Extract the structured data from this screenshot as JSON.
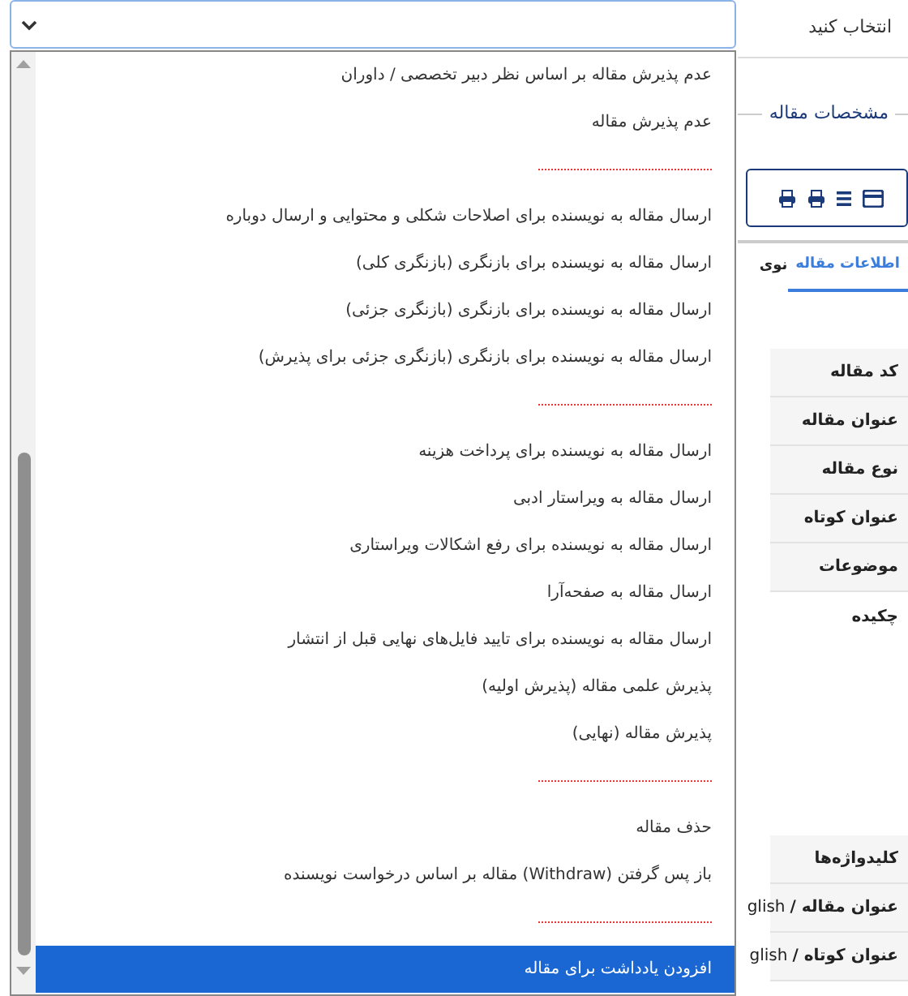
{
  "field_label": "انتخاب کنید",
  "section_title": "مشخصات مقاله",
  "tabs": [
    {
      "label": "اطلاعات مقاله",
      "selected": true
    },
    {
      "label": "نوی",
      "selected": false
    }
  ],
  "info_rows": [
    {
      "label": "کد مقاله"
    },
    {
      "label": "عنوان مقاله"
    },
    {
      "label": "نوع مقاله"
    },
    {
      "label": "عنوان کوتاه"
    },
    {
      "label": "موضوعات"
    },
    {
      "label": "چکیده",
      "kind": "tall"
    },
    {
      "label": "کلیدواژه‌ها"
    },
    {
      "label": "عنوان مقاله /",
      "value": "glish"
    },
    {
      "label": "عنوان کوتاه /",
      "value": "glish"
    }
  ],
  "dropdown_options": [
    {
      "kind": "option",
      "label": "عدم پذیرش مقاله بر اساس نظر دبیر تخصصی / داوران",
      "selected": false
    },
    {
      "kind": "option",
      "label": "عدم پذیرش مقاله",
      "selected": false
    },
    {
      "kind": "separator"
    },
    {
      "kind": "option",
      "label": "ارسال مقاله به نویسنده برای اصلاحات شکلی و محتوایی و ارسال دوباره",
      "selected": false
    },
    {
      "kind": "option",
      "label": "ارسال مقاله به نویسنده برای بازنگری (بازنگری کلی)",
      "selected": false
    },
    {
      "kind": "option",
      "label": "ارسال مقاله به نویسنده برای بازنگری (بازنگری جزئی)",
      "selected": false
    },
    {
      "kind": "option",
      "label": "ارسال مقاله به نویسنده برای بازنگری (بازنگری جزئی برای پذیرش)",
      "selected": false
    },
    {
      "kind": "separator"
    },
    {
      "kind": "option",
      "label": "ارسال مقاله به نویسنده برای پرداخت هزینه",
      "selected": false
    },
    {
      "kind": "option",
      "label": "ارسال مقاله به ویراستار ادبی",
      "selected": false
    },
    {
      "kind": "option",
      "label": "ارسال مقاله به نویسنده برای رفع اشکالات ویراستاری",
      "selected": false
    },
    {
      "kind": "option",
      "label": "ارسال مقاله به صفحه‌آرا",
      "selected": false
    },
    {
      "kind": "option",
      "label": "ارسال مقاله به نویسنده برای تایید فایل‌های نهایی قبل از انتشار",
      "selected": false
    },
    {
      "kind": "option",
      "label": "پذیرش علمی مقاله (پذیرش اولیه)",
      "selected": false
    },
    {
      "kind": "option",
      "label": "پذیرش مقاله (نهایی)",
      "selected": false
    },
    {
      "kind": "separator"
    },
    {
      "kind": "option",
      "label": "حذف مقاله",
      "selected": false
    },
    {
      "kind": "option",
      "label": "باز پس گرفتن (Withdraw) مقاله بر اساس درخواست نویسنده",
      "selected": false
    },
    {
      "kind": "separator"
    },
    {
      "kind": "option",
      "label": "افزودن یادداشت برای مقاله",
      "selected": true
    }
  ]
}
